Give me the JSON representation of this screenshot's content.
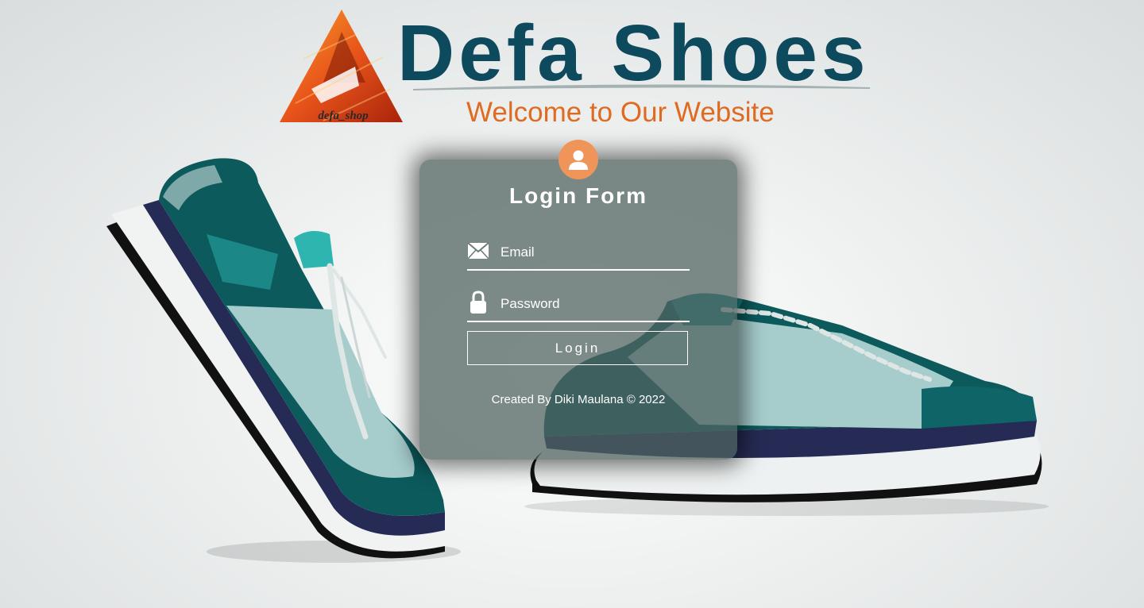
{
  "brand": {
    "logo_text": "defa_shop",
    "title": "Defa Shoes",
    "subtitle": "Welcome to Our Website",
    "title_color": "#0d4a5e",
    "subtitle_color": "#e06a1f",
    "logo_color": "#e8541a"
  },
  "login_form": {
    "avatar_icon": "user-icon",
    "avatar_color": "#f0955a",
    "title": "Login Form",
    "email": {
      "icon": "envelope-icon",
      "placeholder": "Email",
      "value": ""
    },
    "password": {
      "icon": "lock-icon",
      "placeholder": "Password",
      "value": ""
    },
    "submit_label": "Login",
    "credit": "Created By Diki Maulana © 2022"
  },
  "background": {
    "images": [
      "sneaker-left",
      "sneaker-right"
    ],
    "shoe_primary_color": "#0e5a5c",
    "shoe_secondary_color": "#a6cccc"
  }
}
